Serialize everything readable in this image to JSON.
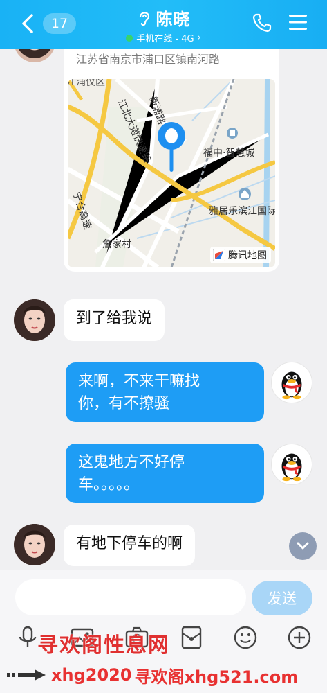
{
  "header": {
    "unread_count": "17",
    "contact_name": "陈晓",
    "status": "手机在线 - 4G",
    "status_chevron": "›"
  },
  "map": {
    "address": "江苏省南京市浦口区镇南河路",
    "labels": {
      "xinpu_road": "新浦路",
      "jiangbei_expressway": "江北大道快速路",
      "ninghe_highway": "宁合高速",
      "fuzhong_mall": "福中·智慧城",
      "yaju": "雅居乐滨江国际",
      "zhanjia": "詹家村",
      "puyi": "江浦仪区"
    },
    "provider": "腾讯地图"
  },
  "messages": [
    {
      "direction": "in",
      "text": "到了给我说"
    },
    {
      "direction": "out",
      "text_line1": "来啊，不来干嘛找",
      "text_line2": "你，有不撩骚"
    },
    {
      "direction": "out",
      "text_line1": "这鬼地方不好停",
      "text_line2": "车。。。。。"
    },
    {
      "direction": "in",
      "text": "有地下停车的啊"
    }
  ],
  "input": {
    "placeholder": "",
    "send_label": "发送"
  },
  "toolbar": {
    "icons": [
      "microphone-icon",
      "image-icon",
      "camera-icon",
      "red-packet-icon",
      "emoji-icon",
      "plus-icon"
    ]
  },
  "watermarks": {
    "line1": "寻欢阁性息网",
    "line2_a": "xhg2020",
    "line2_b": "寻欢阁xhg521.com"
  },
  "colors": {
    "header": "#19b2f5",
    "outgoing_bubble": "#1e9df5",
    "incoming_bubble": "#ffffff",
    "send_button": "#a9d6f7",
    "online_dot": "#39d36b",
    "watermark": "#e03030"
  }
}
